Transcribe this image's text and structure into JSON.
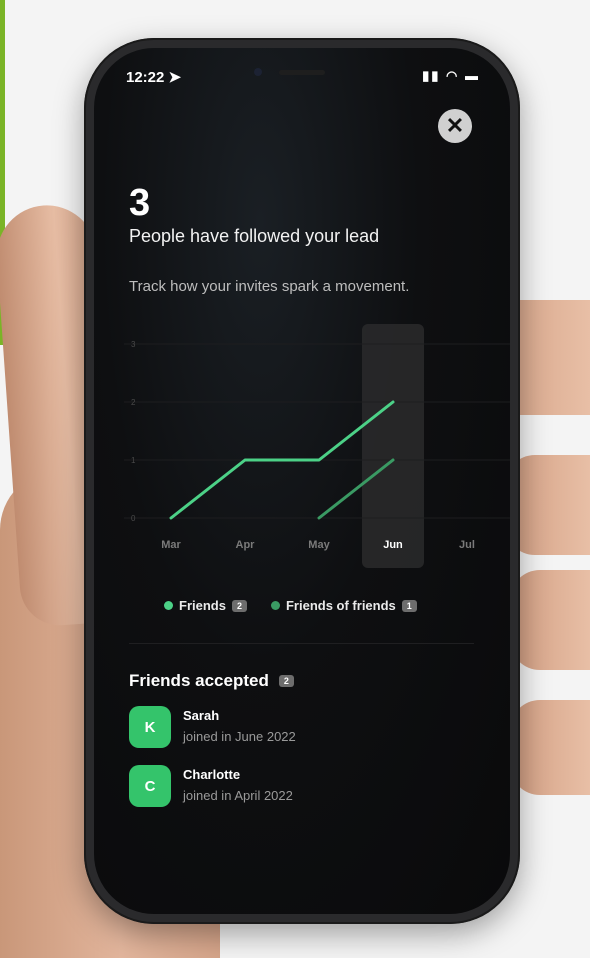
{
  "status_bar": {
    "time": "12:22 ➤",
    "icons": "▮▮ ◠ ▬"
  },
  "close_icon": "✕",
  "hero": {
    "count": "3",
    "headline": "People have followed your lead",
    "subtext": "Track how your invites spark a movement."
  },
  "chart_data": {
    "type": "line",
    "x": [
      "Mar",
      "Apr",
      "May",
      "Jun",
      "Jul"
    ],
    "highlighted_x": "Jun",
    "y_ticks": [
      "0",
      "1",
      "2",
      "3"
    ],
    "ylim": [
      0,
      3
    ],
    "grid": true,
    "series": [
      {
        "name": "Friends",
        "values": [
          0,
          1,
          1,
          2,
          null
        ],
        "color": "#4cd187"
      },
      {
        "name": "Friends of friends",
        "values": [
          null,
          null,
          0,
          1,
          null
        ],
        "color": "#3a9a63"
      }
    ]
  },
  "legend": {
    "friends_label": "Friends",
    "friends_count": "2",
    "fof_label": "Friends of friends",
    "fof_count": "1"
  },
  "friends_section": {
    "title": "Friends accepted",
    "count": "2",
    "items": [
      {
        "initial": "K",
        "name": "Sarah",
        "joined": "joined in June 2022"
      },
      {
        "initial": "C",
        "name": "Charlotte",
        "joined": "joined in April 2022"
      }
    ]
  }
}
